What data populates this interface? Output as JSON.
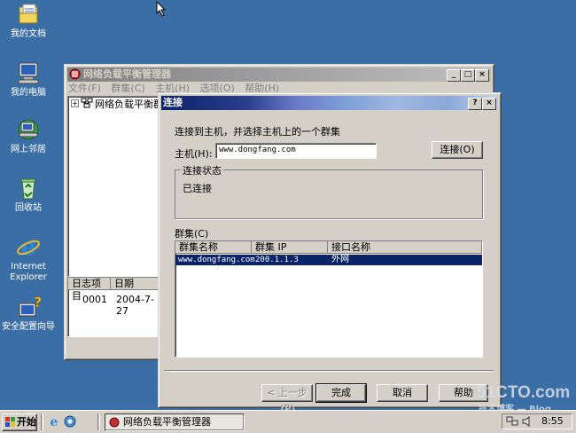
{
  "desktop": {
    "icons": [
      {
        "label": "我的文档",
        "icon": "my-documents-icon"
      },
      {
        "label": "我的电脑",
        "icon": "my-computer-icon"
      },
      {
        "label": "网上邻居",
        "icon": "network-places-icon"
      },
      {
        "label": "回收站",
        "icon": "recycle-bin-icon"
      },
      {
        "label": "Internet\nExplorer",
        "label1": "Internet",
        "label2": "Explorer",
        "icon": "ie-icon"
      },
      {
        "label": "安全配置向导",
        "icon": "security-wizard-icon"
      }
    ]
  },
  "manager": {
    "title": "网络负载平衡管理器",
    "menu": [
      "文件(F)",
      "群集(C)",
      "主机(H)",
      "选项(O)",
      "帮助(H)"
    ],
    "tree_node": "网络负载平衡群",
    "log_headers": [
      "日志项目",
      "日期"
    ],
    "log_row": {
      "item": "0001",
      "date": "2004-7-27"
    }
  },
  "dialog": {
    "title": "连接",
    "instruction": "连接到主机，并选择主机上的一个群集",
    "host_label": "主机(H):",
    "host_value": "www.dongfang.com",
    "connect_button": "连接(O)",
    "status_group": "连接状态",
    "status_text": "已连接",
    "clusters_label": "群集(C)",
    "columns": [
      "群集名称",
      "群集 IP",
      "接口名称"
    ],
    "rows": [
      {
        "name": "www.dongfang.com",
        "ip": "200.1.1.3",
        "iface": "外网"
      }
    ],
    "back_button": "< 上一步(B)",
    "finish_button": "完成",
    "cancel_button": "取消",
    "help_button": "帮助"
  },
  "taskbar": {
    "start": "开始",
    "task": "网络负载平衡管理器",
    "clock": "8:55"
  },
  "watermark": {
    "line1": "51CTO.com",
    "line2": "技术博客 — Blog"
  },
  "colors": {
    "desktop": "#3a6ea5",
    "title_active": "#0a246a",
    "title_inactive": "#808080",
    "selection": "#0a246a"
  }
}
